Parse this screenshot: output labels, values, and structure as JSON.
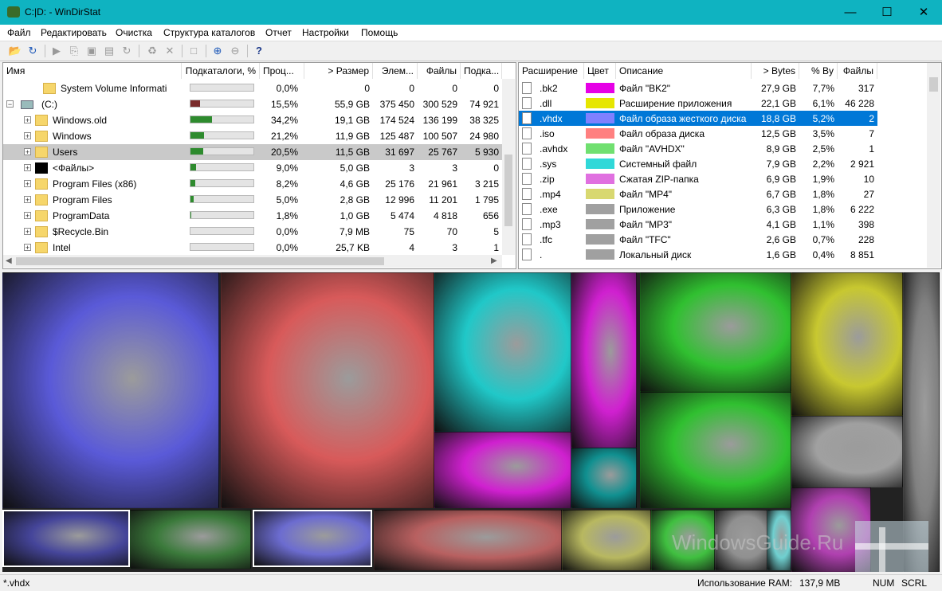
{
  "window": {
    "title": "C:|D: - WinDirStat"
  },
  "menu": [
    "Файл",
    "Редактировать",
    "Очистка",
    "Структура каталогов",
    "Отчет",
    "Настройки",
    "Помощь"
  ],
  "tree": {
    "headers": [
      "Имя",
      "Подкаталоги, %",
      "Проц...",
      "> Размер",
      "Элем...",
      "Файлы",
      "Подка..."
    ],
    "rows": [
      {
        "name": "System Volume Informati",
        "bar": 0.0,
        "pct": "0,0%",
        "size": "0",
        "items": "0",
        "files": "0",
        "sub": "0",
        "color": "#2e8b2e"
      },
      {
        "name": "(C:)",
        "bar": 0.155,
        "pct": "15,5%",
        "size": "55,9 GB",
        "items": "375 450",
        "files": "300 529",
        "sub": "74 921",
        "color": "#7a2a2a"
      },
      {
        "name": "Windows.old",
        "bar": 0.342,
        "pct": "34,2%",
        "size": "19,1 GB",
        "items": "174 524",
        "files": "136 199",
        "sub": "38 325",
        "color": "#2e8b2e"
      },
      {
        "name": "Windows",
        "bar": 0.212,
        "pct": "21,2%",
        "size": "11,9 GB",
        "items": "125 487",
        "files": "100 507",
        "sub": "24 980",
        "color": "#2e8b2e"
      },
      {
        "name": "Users",
        "bar": 0.205,
        "pct": "20,5%",
        "size": "11,5 GB",
        "items": "31 697",
        "files": "25 767",
        "sub": "5 930",
        "color": "#2e8b2e"
      },
      {
        "name": "<Файлы>",
        "bar": 0.09,
        "pct": "9,0%",
        "size": "5,0 GB",
        "items": "3",
        "files": "3",
        "sub": "0",
        "color": "#2e8b2e"
      },
      {
        "name": "Program Files (x86)",
        "bar": 0.082,
        "pct": "8,2%",
        "size": "4,6 GB",
        "items": "25 176",
        "files": "21 961",
        "sub": "3 215",
        "color": "#2e8b2e"
      },
      {
        "name": "Program Files",
        "bar": 0.05,
        "pct": "5,0%",
        "size": "2,8 GB",
        "items": "12 996",
        "files": "11 201",
        "sub": "1 795",
        "color": "#2e8b2e"
      },
      {
        "name": "ProgramData",
        "bar": 0.018,
        "pct": "1,8%",
        "size": "1,0 GB",
        "items": "5 474",
        "files": "4 818",
        "sub": "656",
        "color": "#2e8b2e"
      },
      {
        "name": "$Recycle.Bin",
        "bar": 0.0,
        "pct": "0,0%",
        "size": "7,9 MB",
        "items": "75",
        "files": "70",
        "sub": "5",
        "color": "#2e8b2e"
      },
      {
        "name": "Intel",
        "bar": 0.0,
        "pct": "0,0%",
        "size": "25,7 KB",
        "items": "4",
        "files": "3",
        "sub": "1",
        "color": "#2e8b2e"
      }
    ]
  },
  "ext": {
    "headers": [
      "Расширение",
      "Цвет",
      "Описание",
      "> Bytes",
      "% By",
      "Файлы"
    ],
    "rows": [
      {
        "ext": ".bk2",
        "color": "#e600e6",
        "desc": "Файл \"BK2\"",
        "bytes": "27,9 GB",
        "pct": "7,7%",
        "files": "317"
      },
      {
        "ext": ".dll",
        "color": "#e6e600",
        "desc": "Расширение приложения",
        "bytes": "22,1 GB",
        "pct": "6,1%",
        "files": "46 228"
      },
      {
        "ext": ".vhdx",
        "color": "#8080ff",
        "desc": "Файл образа жесткого диска",
        "bytes": "18,8 GB",
        "pct": "5,2%",
        "files": "2"
      },
      {
        "ext": ".iso",
        "color": "#ff8080",
        "desc": "Файл образа диска",
        "bytes": "12,5 GB",
        "pct": "3,5%",
        "files": "7"
      },
      {
        "ext": ".avhdx",
        "color": "#70e070",
        "desc": "Файл \"AVHDX\"",
        "bytes": "8,9 GB",
        "pct": "2,5%",
        "files": "1"
      },
      {
        "ext": ".sys",
        "color": "#30d8d8",
        "desc": "Системный файл",
        "bytes": "7,9 GB",
        "pct": "2,2%",
        "files": "2 921"
      },
      {
        "ext": ".zip",
        "color": "#e070e0",
        "desc": "Сжатая ZIP-папка",
        "bytes": "6,9 GB",
        "pct": "1,9%",
        "files": "10"
      },
      {
        "ext": ".mp4",
        "color": "#d8d870",
        "desc": "Файл \"MP4\"",
        "bytes": "6,7 GB",
        "pct": "1,8%",
        "files": "27"
      },
      {
        "ext": ".exe",
        "color": "#a0a0a0",
        "desc": "Приложение",
        "bytes": "6,3 GB",
        "pct": "1,8%",
        "files": "6 222"
      },
      {
        "ext": ".mp3",
        "color": "#a0a0a0",
        "desc": "Файл \"MP3\"",
        "bytes": "4,1 GB",
        "pct": "1,1%",
        "files": "398"
      },
      {
        "ext": ".tfc",
        "color": "#a0a0a0",
        "desc": "Файл \"TFC\"",
        "bytes": "2,6 GB",
        "pct": "0,7%",
        "files": "228"
      },
      {
        "ext": ".",
        "color": "#a0a0a0",
        "desc": "Локальный диск",
        "bytes": "1,6 GB",
        "pct": "0,4%",
        "files": "8 851"
      }
    ]
  },
  "status": {
    "left": "*.vhdx",
    "ram_label": "Использование RAM:",
    "ram_value": "137,9 MB",
    "num": "NUM",
    "scrl": "SCRL"
  },
  "watermark": "WindowsGuide.Ru",
  "colors": {
    "accent": "#0fb3c1",
    "selection": "#0078d7"
  }
}
